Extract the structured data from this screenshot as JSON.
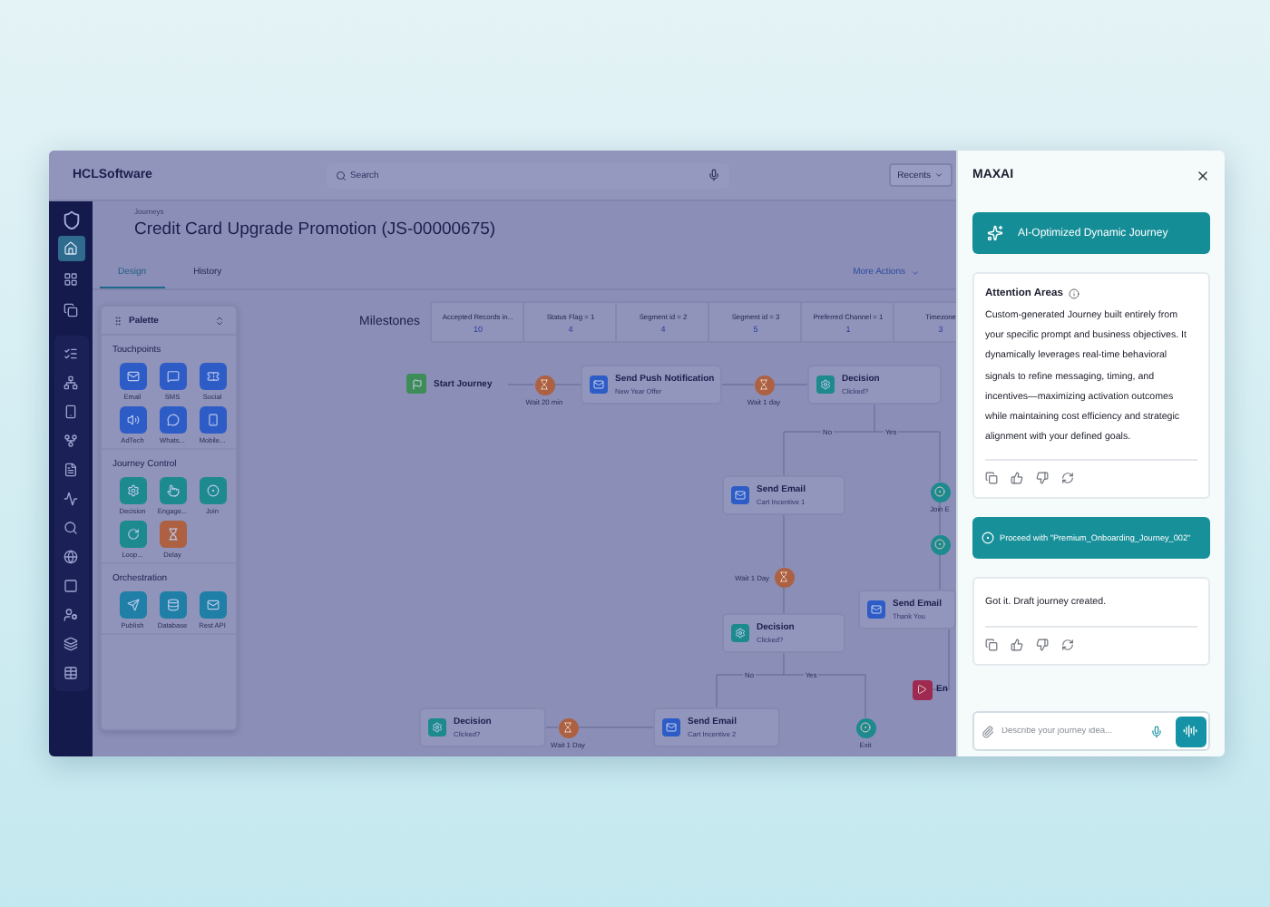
{
  "header": {
    "brand": "HCLSoftware",
    "search": {
      "placeholder": "Search"
    },
    "recents": "Recents"
  },
  "nav_items": [
    {
      "selected": true
    },
    {
      "selected": false
    },
    {
      "selected": false
    },
    {
      "selected": false
    },
    {
      "selected": false
    },
    {
      "selected": false
    },
    {
      "selected": false
    },
    {
      "selected": false
    },
    {
      "selected": false
    },
    {
      "selected": false
    },
    {
      "selected": false
    },
    {
      "selected": false
    },
    {
      "selected": false
    },
    {
      "selected": false
    },
    {
      "selected": false
    }
  ],
  "breadcrumb": "Journeys",
  "title": "Credit Card Upgrade Promotion (JS-00000675)",
  "tabs": [
    {
      "label": "Design",
      "selected": true
    },
    {
      "label": "History",
      "selected": false
    }
  ],
  "more_actions": "More Actions",
  "palette": {
    "title": "Palette",
    "sections": [
      {
        "title": "Touchpoints",
        "items": [
          {
            "label": "Email",
            "color": "#2d5cc6"
          },
          {
            "label": "SMS",
            "color": "#2d5cc6"
          },
          {
            "label": "Social",
            "color": "#2d5cc6"
          },
          {
            "label": "AdTech",
            "color": "#2d5cc6"
          },
          {
            "label": "Whats...",
            "color": "#2d5cc6"
          },
          {
            "label": "Mobile...",
            "color": "#2d5cc6"
          }
        ]
      },
      {
        "title": "Journey Control",
        "items": [
          {
            "label": "Decision",
            "color": "#1d8a8f"
          },
          {
            "label": "Engage...",
            "color": "#1d8a8f"
          },
          {
            "label": "Join",
            "color": "#1d8a8f"
          },
          {
            "label": "Loop...",
            "color": "#1d8a8f"
          },
          {
            "label": "Delay",
            "color": "#ad6142"
          }
        ]
      },
      {
        "title": "Orchestration",
        "items": [
          {
            "label": "Publish",
            "color": "#1f7fa6"
          },
          {
            "label": "Database",
            "color": "#1f7fa6"
          },
          {
            "label": "Rest API",
            "color": "#1f7fa6"
          }
        ]
      }
    ]
  },
  "milestones": {
    "title": "Milestones",
    "items": [
      {
        "label": "Accepted Records in...",
        "value": "10"
      },
      {
        "label": "Status Flag = 1",
        "value": "4"
      },
      {
        "label": "Segment id = 2",
        "value": "4"
      },
      {
        "label": "Segment id = 3",
        "value": "5"
      },
      {
        "label": "Preferred Channel = 1",
        "value": "1"
      },
      {
        "label": "Timezone",
        "value": "3"
      }
    ]
  },
  "canvas": {
    "nodes": [
      {
        "kind": "start",
        "label": "Start Journey"
      },
      {
        "kind": "wait",
        "label": "Wait 20 min"
      },
      {
        "kind": "action",
        "label": "Send Push Notification",
        "detail": "New Year Offer"
      },
      {
        "kind": "wait",
        "label": "Wait 1 day"
      },
      {
        "kind": "decision",
        "label": "Decision",
        "detail": "Clicked?"
      },
      {
        "kind": "action",
        "label": "Send Email",
        "detail": "Cart Incentive 1"
      },
      {
        "kind": "wait",
        "label": "Wait 1 Day"
      },
      {
        "kind": "decision",
        "label": "Decision",
        "detail": "Clicked?"
      },
      {
        "kind": "decision",
        "label": "Decision",
        "detail": "Clicked?"
      },
      {
        "kind": "wait",
        "label": "Wait 1 Day"
      },
      {
        "kind": "action",
        "label": "Send Email",
        "detail": "Cart Incentive 2"
      },
      {
        "kind": "exit",
        "label": "Exit"
      },
      {
        "kind": "join",
        "label": "Join E"
      },
      {
        "kind": "join"
      },
      {
        "kind": "action",
        "label": "Send Email",
        "detail": "Thank You"
      },
      {
        "kind": "end",
        "label": "En"
      }
    ],
    "branch_labels": [
      "No",
      "Yes",
      "No",
      "Yes"
    ]
  },
  "assistant": {
    "title": "MAXAI",
    "messages": [
      {
        "kind": "highlight",
        "text": "AI-Optimized Dynamic Journey"
      },
      {
        "kind": "reply",
        "heading": "Attention Areas",
        "text": "Custom-generated Journey built entirely from your specific prompt and business objectives. It dynamically leverages real-time behavioral signals to refine messaging, timing, and incentives—maximizing activation outcomes while maintaining cost efficiency and strategic alignment with your defined goals."
      },
      {
        "kind": "prompt",
        "text": "Proceed with \"Premium_Onboarding_Journey_002\""
      },
      {
        "kind": "reply",
        "text": "Got it. Draft journey created."
      }
    ],
    "input": {
      "placeholder": "Describe your journey idea..."
    }
  }
}
